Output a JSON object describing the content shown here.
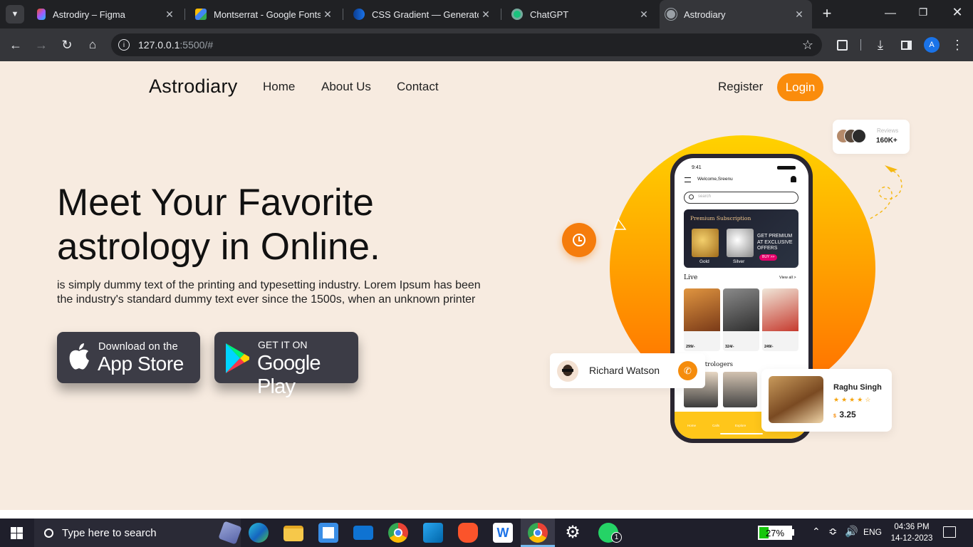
{
  "browser": {
    "tabs": [
      {
        "title": "Astrodiry – Figma"
      },
      {
        "title": "Montserrat - Google Fonts"
      },
      {
        "title": "CSS Gradient — Generator, I"
      },
      {
        "title": "ChatGPT"
      },
      {
        "title": "Astrodiary"
      }
    ],
    "url_host": "127.0.0.1",
    "url_path": ":5500/#",
    "profile_initial": "A"
  },
  "nav": {
    "logo": "Astrodiary",
    "links": [
      "Home",
      "About Us",
      "Contact"
    ],
    "register": "Register",
    "login": "Login"
  },
  "hero": {
    "headline_line1": "Meet Your Favorite",
    "headline_line2": "astrology in Online.",
    "description": "is simply dummy text of the printing and typesetting industry. Lorem Ipsum has been the industry's standard dummy text ever since the 1500s, when an unknown printer",
    "appstore_small": "Download on the",
    "appstore_big": "App Store",
    "googleplay_small": "GET IT ON",
    "googleplay_big": "Google Play"
  },
  "reviews": {
    "label": "Reviews",
    "count": "160K+"
  },
  "caller_card": {
    "name": "Richard Watson"
  },
  "astrologer_card": {
    "name": "Raghu Singh",
    "currency": "$",
    "price": "3.25",
    "rating": 4
  },
  "phone": {
    "time": "9:41",
    "welcome": "Welcome,Sreenu",
    "search_placeholder": "search",
    "premium_title": "Premium Subscription",
    "premium_offer": "GET PREMIUM AT EXCLUSIVE OFFERS",
    "buy": "BUY >>",
    "gold": "Gold",
    "silver": "Silver",
    "live": "Live",
    "view_all": "View all >",
    "live_prices": [
      "299/-",
      "324/-",
      "249/-"
    ],
    "section2": "Our Astrologers",
    "nav_home": "Home",
    "nav_calls": "Calls",
    "nav_explore": "Explore"
  },
  "taskbar": {
    "search_placeholder": "Type here to search",
    "battery": "27%",
    "lang": "ENG",
    "time": "04:36 PM",
    "date": "14-12-2023",
    "whatsapp_badge": "1"
  },
  "colors": {
    "accent": "#fa8c0c",
    "page_bg": "#f7ebe0",
    "store_btn": "#3c3c46"
  }
}
